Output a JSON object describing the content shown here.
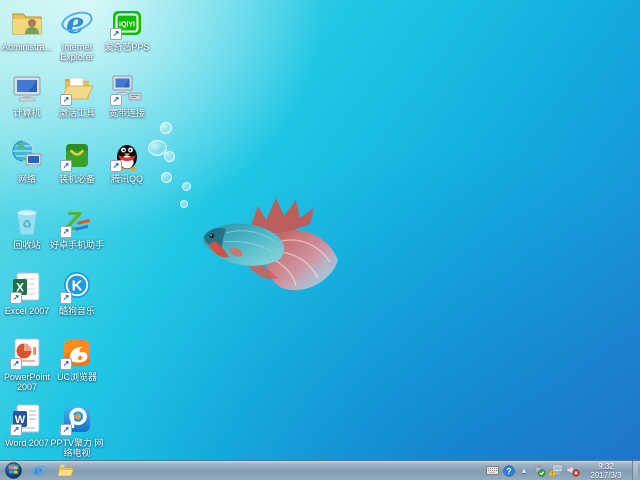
{
  "desktop": {
    "icons": [
      {
        "name": "administrator-folder",
        "label": "Administra..."
      },
      {
        "name": "internet-explorer",
        "label": "Internet Explorer"
      },
      {
        "name": "iqiyi-pps",
        "label": "爱奇艺PPS"
      },
      {
        "name": "computer",
        "label": "计算机"
      },
      {
        "name": "activation-tools",
        "label": "激活工具"
      },
      {
        "name": "broadband-connection",
        "label": "宽带连接"
      },
      {
        "name": "network",
        "label": "网络"
      },
      {
        "name": "essential-software",
        "label": "装机必备"
      },
      {
        "name": "tencent-qq",
        "label": "腾讯QQ"
      },
      {
        "name": "recycle-bin",
        "label": "回收站"
      },
      {
        "name": "haozhuo-phone-assistant",
        "label": "好卓手机助手"
      },
      {
        "name": "excel-2007",
        "label": "Excel 2007"
      },
      {
        "name": "kugou-music",
        "label": "酷狗音乐"
      },
      {
        "name": "powerpoint-2007",
        "label": "PowerPoint 2007"
      },
      {
        "name": "uc-browser",
        "label": "UC浏览器"
      },
      {
        "name": "word-2007",
        "label": "Word 2007"
      },
      {
        "name": "pptv",
        "label": "PPTV聚力 网络电视"
      }
    ]
  },
  "glyphs": {
    "ie": "e",
    "iqiyi": "iQIYI",
    "haozhuo": "Z",
    "excel": "X",
    "kugou": "K",
    "word": "W",
    "recycle": "♻",
    "help": "?",
    "shortcut_arrow": "↗",
    "hidden_icons_caret": "▴"
  },
  "taskbar": {
    "clock": {
      "time": "9:32",
      "date": "2017/3/3"
    },
    "tray_icons": [
      "input-keyboard",
      "help",
      "show-hidden-icons",
      "safely-remove-hardware",
      "network-warning",
      "volume-muted"
    ]
  },
  "colors": {
    "wallpaper_top_left": "#a3e9e6",
    "wallpaper_center": "#15b4e0",
    "wallpaper_bottom_right": "#2278cf",
    "taskbar": "#849cb3",
    "iqiyi_green": "#0bbe06",
    "uc_orange": "#ff8a1e",
    "qq_red_scarf": "#e03030",
    "excel_green": "#1f7244",
    "word_blue": "#27549e",
    "kugou_blue": "#1f9ae0",
    "pptv_blue": "#1e8fdd",
    "pptv_orange": "#ff9a1e",
    "mute_red": "#d03028",
    "check_green": "#39a33c",
    "warning_yellow": "#f5c518"
  }
}
